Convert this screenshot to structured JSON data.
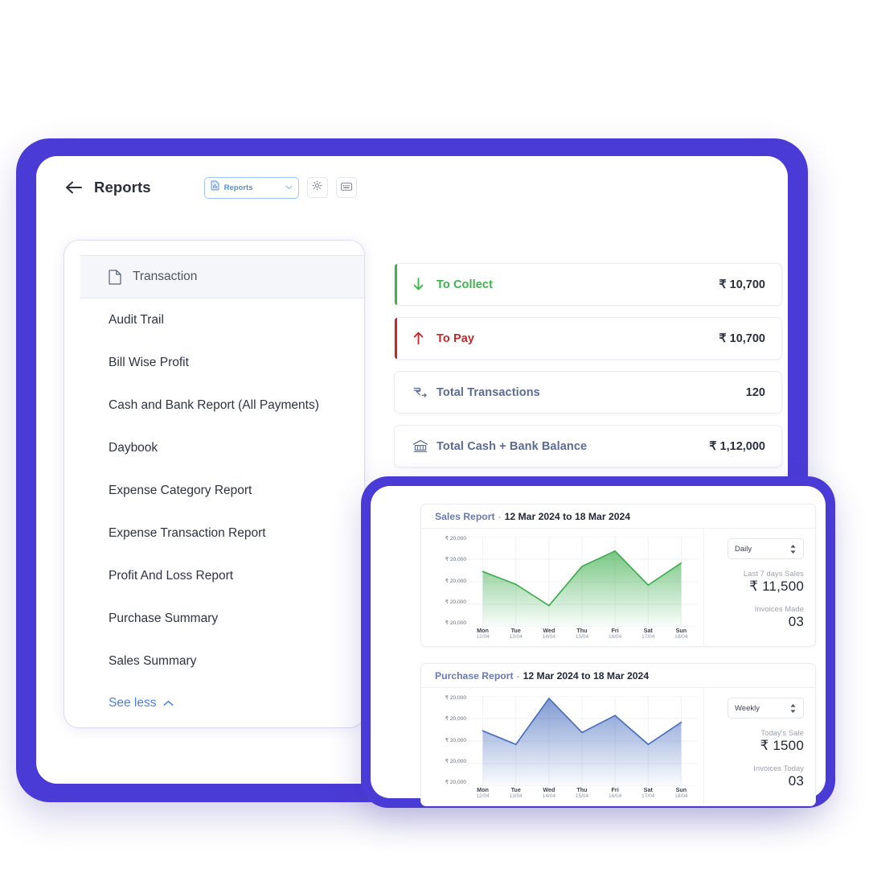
{
  "header": {
    "back_icon": "arrow-left-icon",
    "title": "Reports",
    "report_select": {
      "icon": "report-doc-icon",
      "label": "Reports",
      "chevron": "chevron-down-icon"
    },
    "settings_icon": "gear-icon",
    "keyboard_icon": "keyboard-icon"
  },
  "reports_list": {
    "items": [
      {
        "label": "Transaction",
        "icon": "document-icon",
        "active": true
      },
      {
        "label": "Audit Trail",
        "active": false
      },
      {
        "label": "Bill Wise Profit",
        "active": false
      },
      {
        "label": "Cash and Bank Report (All Payments)",
        "active": false
      },
      {
        "label": "Daybook",
        "active": false
      },
      {
        "label": "Expense Category Report",
        "active": false
      },
      {
        "label": "Expense Transaction Report",
        "active": false
      },
      {
        "label": "Profit And Loss Report",
        "active": false
      },
      {
        "label": "Purchase Summary",
        "active": false
      },
      {
        "label": "Sales Summary",
        "active": false
      }
    ],
    "see_less": {
      "label": "See less",
      "chevron": "chevron-up-icon"
    }
  },
  "summary_cards": [
    {
      "icon": "arrow-down-icon",
      "label": "To Collect",
      "value": "₹ 10,700",
      "color": "#3CB44A",
      "accent": "#3CB44A"
    },
    {
      "icon": "arrow-up-icon",
      "label": "To Pay",
      "value": "₹ 10,700",
      "color": "#C22A2A",
      "accent": "#C22A2A"
    },
    {
      "icon": "rupee-transfer-icon",
      "label": "Total Transactions",
      "value": "120",
      "color": "#5A6C94",
      "accent": "transparent"
    },
    {
      "icon": "bank-icon",
      "label": "Total Cash + Bank Balance",
      "value": "₹ 1,12,000",
      "color": "#5A6C94",
      "accent": "transparent"
    }
  ],
  "charts": [
    {
      "title": "Sales Report",
      "dash": "-",
      "range": "12 Mar 2024 to 18 Mar 2024",
      "period": {
        "label": "Daily",
        "stepper": "stepper-icon"
      },
      "stat1_label": "Last 7 days Sales",
      "stat1_value": "₹ 11,500",
      "stat2_label": "Invoices Made",
      "stat2_value": "03"
    },
    {
      "title": "Purchase Report",
      "dash": "-",
      "range": "12 Mar 2024 to 18 Mar 2024",
      "period": {
        "label": "Weekly",
        "stepper": "stepper-icon"
      },
      "stat1_label": "Today's Sale",
      "stat1_value": "₹ 1500",
      "stat2_label": "Invoices Today",
      "stat2_value": "03"
    }
  ],
  "chart_data": [
    {
      "type": "area",
      "title": "Sales Report",
      "subtitle": "12 Mar 2024 to 18 Mar 2024",
      "xlabel": "",
      "ylabel": "",
      "categories": [
        "Mon",
        "Tue",
        "Wed",
        "Thu",
        "Fri",
        "Sat",
        "Sun"
      ],
      "category_dates": [
        "12/04",
        "13/04",
        "14/04",
        "15/04",
        "16/04",
        "17/04",
        "18/04"
      ],
      "ytick_labels": [
        "₹ 20,000",
        "₹ 20,000",
        "₹ 20,000",
        "₹ 20,000",
        "₹ 20,000"
      ],
      "ylim": [
        0,
        100
      ],
      "grid": true,
      "legend": "none",
      "series": [
        {
          "name": "Sales",
          "color": "#3FAE4F",
          "values": [
            62,
            47,
            22,
            68,
            86,
            46,
            72
          ]
        }
      ]
    },
    {
      "type": "area",
      "title": "Purchase Report",
      "subtitle": "12 Mar 2024 to 18 Mar 2024",
      "xlabel": "",
      "ylabel": "",
      "categories": [
        "Mon",
        "Tue",
        "Wed",
        "Thu",
        "Fri",
        "Sat",
        "Sun"
      ],
      "category_dates": [
        "12/04",
        "13/04",
        "14/04",
        "15/04",
        "16/04",
        "17/04",
        "18/04"
      ],
      "ytick_labels": [
        "₹ 20,000",
        "₹ 20,000",
        "₹ 20,000",
        "₹ 20,000",
        "₹ 20,000"
      ],
      "ylim": [
        0,
        100
      ],
      "grid": true,
      "legend": "none",
      "series": [
        {
          "name": "Purchase",
          "color": "#4A6FBF",
          "values": [
            62,
            46,
            100,
            60,
            80,
            46,
            72
          ]
        }
      ]
    }
  ],
  "theme": {
    "frame": "#4B3BD6",
    "accent_blue": "#4C7FE8",
    "text": "#2B2F3A"
  }
}
